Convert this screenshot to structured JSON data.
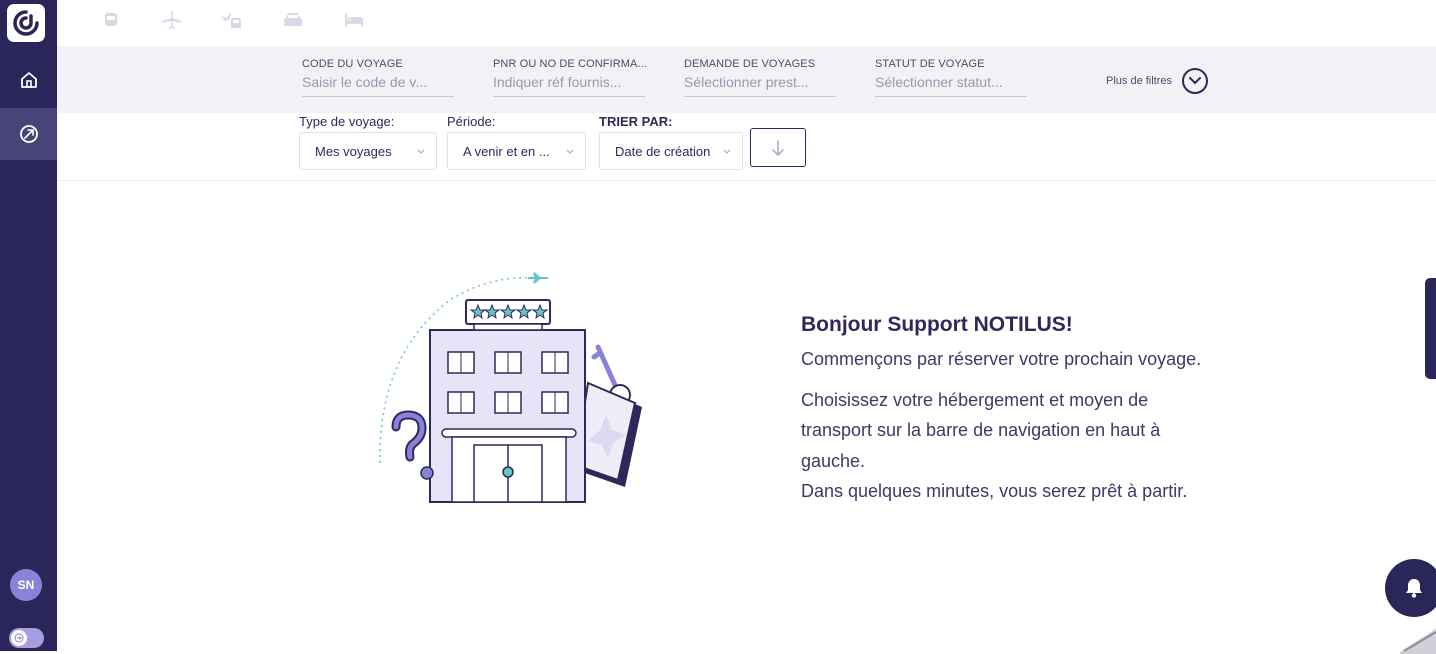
{
  "sidebar": {
    "avatar_initials": "SN",
    "items": [
      {
        "icon": "home-icon"
      },
      {
        "icon": "compass-icon",
        "active": true
      }
    ]
  },
  "topnav": {
    "icons": [
      "train-icon",
      "plane-icon",
      "plane-train-icon",
      "car-icon",
      "bed-icon"
    ]
  },
  "filters": [
    {
      "label": "CODE DU VOYAGE",
      "placeholder": "Saisir le code de v..."
    },
    {
      "label": "PNR OU NO DE CONFIRMA...",
      "placeholder": "Indiquer réf fournis..."
    },
    {
      "label": "DEMANDE DE VOYAGES",
      "placeholder": "Sélectionner prest..."
    },
    {
      "label": "STATUT DE VOYAGE",
      "placeholder": "Sélectionner statut..."
    }
  ],
  "more_filters_label": "Plus de filtres",
  "sort": {
    "type_label": "Type de voyage:",
    "type_value": "Mes voyages",
    "period_label": "Période:",
    "period_value": "A venir et en ...",
    "sort_label": "TRIER PAR:",
    "sort_value": "Date de création"
  },
  "welcome": {
    "title": "Bonjour Support NOTILUS!",
    "line1": "Commençons par réserver votre prochain voyage.",
    "line2a": "Choisissez votre hébergement et moyen de",
    "line2b": "transport sur la barre de navigation en haut à",
    "line2c": "gauche.",
    "line3": "Dans quelques minutes, vous serez prêt à partir."
  },
  "colors": {
    "sidebar": "#2b2659",
    "sidebar_active": "#48447a",
    "accent": "#8a82d8",
    "text": "#2d2a5b",
    "filterbar": "#f2f2f6"
  }
}
